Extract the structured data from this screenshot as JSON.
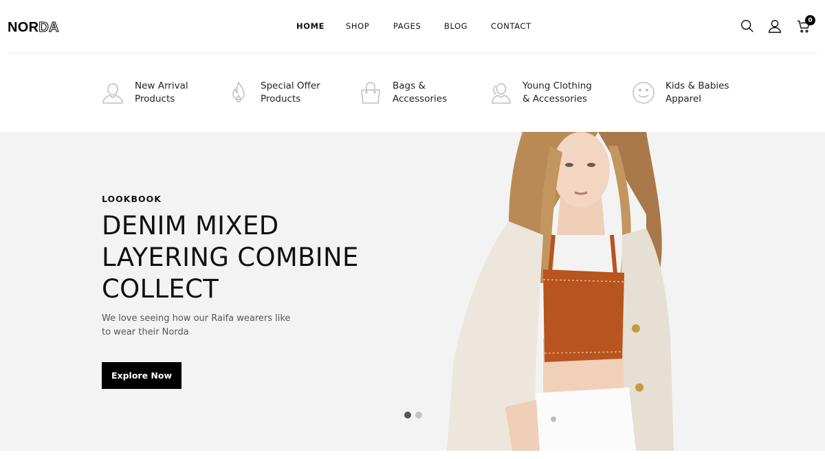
{
  "brand": {
    "logo_solid": "NOR",
    "logo_outline": "DA"
  },
  "nav": {
    "items": [
      {
        "label": "HOME",
        "active": true
      },
      {
        "label": "SHOP",
        "active": false
      },
      {
        "label": "PAGES",
        "active": false
      },
      {
        "label": "BLOG",
        "active": false
      },
      {
        "label": "CONTACT",
        "active": false
      }
    ]
  },
  "header_icons": {
    "search": "search-icon",
    "account": "user-icon",
    "cart": "cart-icon",
    "cart_count": "0"
  },
  "categories": [
    {
      "line1": "New Arrival",
      "line2": "Products",
      "icon": "user-icon"
    },
    {
      "line1": "Special Offer",
      "line2": "Products",
      "icon": "flame-icon"
    },
    {
      "line1": "Bags &",
      "line2": "Accessories",
      "icon": "bag-icon"
    },
    {
      "line1": "Young Clothing",
      "line2": "& Accessories",
      "icon": "users-icon"
    },
    {
      "line1": "Kids & Babies",
      "line2": "Apparel",
      "icon": "smile-icon"
    }
  ],
  "hero": {
    "eyebrow": "LOOKBOOK",
    "headline_lines": [
      "DENIM MIXED",
      "LAYERING COMBINE",
      "COLLECT"
    ],
    "description": "We love seeing how our Raifa wearers like to wear their Norda",
    "cta_label": "Explore Now",
    "slides_total": 2,
    "slide_active": 1
  },
  "colors": {
    "accent": "#000000",
    "hero_bg": "#f3f3f3",
    "top_color": "#b8541f"
  }
}
